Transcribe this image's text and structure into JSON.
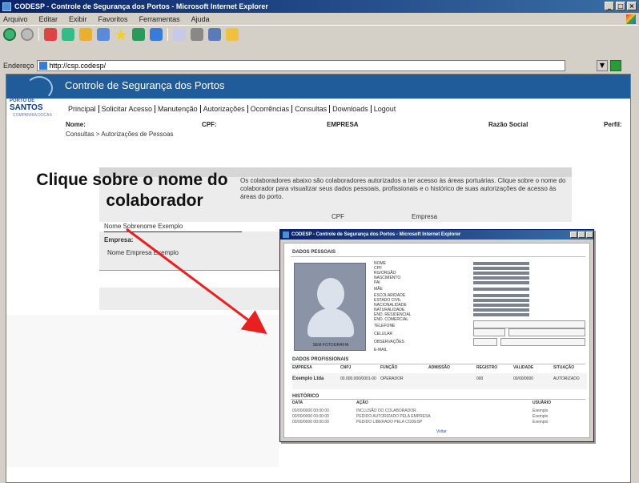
{
  "window": {
    "title": "CODESP - Controle de Segurança dos Portos - Microsoft Internet Explorer"
  },
  "menu": [
    "Arquivo",
    "Editar",
    "Exibir",
    "Favoritos",
    "Ferramentas",
    "Ajuda"
  ],
  "address": {
    "label": "Endereço",
    "url": "http://csp.codesp/"
  },
  "app": {
    "banner_title": "Controle de Segurança dos Portos",
    "logo": {
      "top": "PORTO DE",
      "main": "SANTOS",
      "sub": "COMPANHIA DOCAS"
    },
    "nav": [
      "Principal",
      "Solicitar Acesso",
      "Manutenção",
      "Autorizações",
      "Ocorrências",
      "Consultas",
      "Downloads",
      "Logout"
    ],
    "info": {
      "nome": "Nome:",
      "cpf": "CPF:",
      "empresa": "EMPRESA",
      "razao": "Razão Social",
      "perfil": "Perfil:"
    },
    "subtitle": "Consultas > Autorizações de Pessoas",
    "panel": {
      "dotted_text": "Os colaboradores abaixo são colaboradores autorizados a ter acesso às áreas portuárias. Clique sobre o nome do colaborador para visualizar seus dados pessoais, profissionais e o histórico de suas autorizações de acesso às áreas do porto.",
      "col_cpf": "CPF",
      "col_empresa": "Empresa",
      "employee_name": "Nome Sobrenome Exemplo",
      "employer_label": "Empresa:",
      "employer_value": "Nome Empresa Exemplo"
    }
  },
  "callout": {
    "line1": "Clique sobre o nome do",
    "line2": "colaborador"
  },
  "popup": {
    "title": "CODESP - Controle de Segurança dos Portos - Microsoft Internet Explorer",
    "section_personal": "DADOS PESSOAIS",
    "section_professional": "DADOS PROFISSIONAIS",
    "section_history": "HISTÓRICO",
    "photo_label": "SEM FOTOGRAFIA",
    "fields": [
      "NOME",
      "CPF",
      "RG/ORGÃO",
      "NASCIMENTO",
      "PAI",
      "MÃE",
      "ESCOLARIDADE",
      "ESTADO CIVIL",
      "NACIONALIDADE",
      "NATURALIDADE",
      "END. RESIDENCIAL",
      "END. COMERCIAL",
      "TELEFONE",
      "CELULAR",
      "OBSERVAÇÕES",
      "E-MAIL"
    ],
    "prof_headers": [
      "EMPRESA",
      "CNPJ",
      "FUNÇÃO",
      "ADMISSÃO",
      "REGISTRO",
      "VALIDADE",
      "SITUAÇÃO"
    ],
    "prof_row": {
      "empresa": "Exemplo Ltda",
      "cnpj": "00.000.000/0001-00",
      "funcao": "OPERADOR",
      "registro": "000",
      "validade": "00/00/0000",
      "situacao": "AUTORIZADO"
    },
    "hist_headers": [
      "DATA",
      "AÇÃO",
      "USUÁRIO"
    ],
    "hist_rows": [
      {
        "data": "00/00/0000 00:00:00",
        "acao": "INCLUSÃO DO COLABORADOR",
        "usuario": "Exemplo"
      },
      {
        "data": "00/00/0000 00:00:00",
        "acao": "PEDIDO AUTORIZADO PELA EMPRESA",
        "usuario": "Exemplo"
      },
      {
        "data": "00/00/0000 00:00:00",
        "acao": "PEDIDO LIBERADO PELA CODESP",
        "usuario": "Exemplo"
      }
    ],
    "back_link": "Voltar"
  }
}
